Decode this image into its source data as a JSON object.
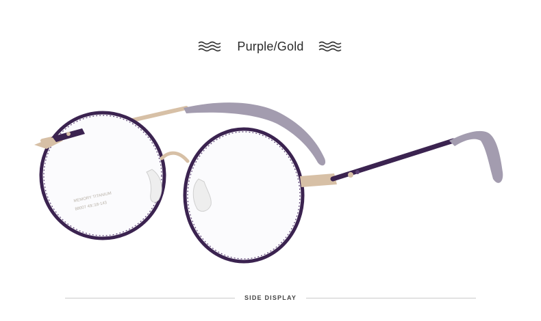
{
  "product": {
    "color_label": "Purple/Gold",
    "frame_print_line1": "MEMORY TITANIUM",
    "frame_print_line2": "88007  49□18-143"
  },
  "footer": {
    "label": "SIDE DISPLAY"
  },
  "colors": {
    "frame_purple": "#3b2350",
    "frame_gold": "#d7c0a6",
    "temple_tip": "#a39caf",
    "background": "#ffffff"
  },
  "icons": {
    "left_decoration": "wave-icon",
    "right_decoration": "wave-icon"
  }
}
